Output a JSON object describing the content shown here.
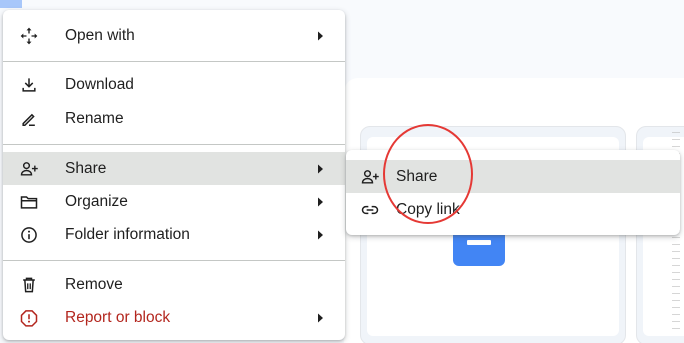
{
  "context_menu": {
    "items": [
      {
        "id": "open-with",
        "label": "Open with",
        "icon": "open-with-icon",
        "has_submenu": true
      },
      {
        "id": "download",
        "label": "Download",
        "icon": "download-icon",
        "has_submenu": false
      },
      {
        "id": "rename",
        "label": "Rename",
        "icon": "rename-icon",
        "has_submenu": false
      },
      {
        "id": "share",
        "label": "Share",
        "icon": "share-icon",
        "has_submenu": true,
        "highlighted": true
      },
      {
        "id": "organize",
        "label": "Organize",
        "icon": "folder-icon",
        "has_submenu": true
      },
      {
        "id": "folder-information",
        "label": "Folder information",
        "icon": "info-icon",
        "has_submenu": true
      },
      {
        "id": "remove",
        "label": "Remove",
        "icon": "trash-icon",
        "has_submenu": false
      },
      {
        "id": "report-or-block",
        "label": "Report or block",
        "icon": "report-icon",
        "has_submenu": true,
        "danger": true
      }
    ]
  },
  "share_submenu": {
    "items": [
      {
        "id": "share",
        "label": "Share",
        "icon": "share-icon",
        "highlighted": true
      },
      {
        "id": "copy-link",
        "label": "Copy link",
        "icon": "link-icon"
      }
    ]
  },
  "colors": {
    "highlight": "#e1e3e1",
    "danger": "#b3261e",
    "annotation": "#e53935",
    "doc_icon": "#4285f4"
  }
}
